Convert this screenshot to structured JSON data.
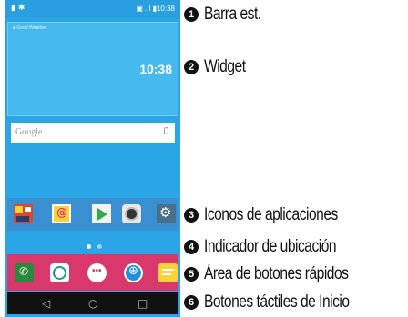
{
  "status_bar": {
    "left": "▮ ✱",
    "right": "▣ .ıl ▮10:38"
  },
  "widget": {
    "small_text": "■ Good Weather",
    "clock": "10:38"
  },
  "search": {
    "label": "Google"
  },
  "nav": {
    "back": "◁",
    "home": "○",
    "recent": "□"
  },
  "callouts": [
    {
      "number": "1",
      "label": "Barra est."
    },
    {
      "number": "2",
      "label": "Widget"
    },
    {
      "number": "3",
      "label": "Iconos de aplicaciones"
    },
    {
      "number": "4",
      "label": "Indicador de ubicación"
    },
    {
      "number": "5",
      "label": "Área de botones rápidos"
    },
    {
      "number": "6",
      "label": "Botones táctiles de Inicio"
    }
  ],
  "colors": {
    "screen": "#2aa6e6",
    "quick_bar": "#d8386b",
    "nav_bar": "#111111"
  }
}
